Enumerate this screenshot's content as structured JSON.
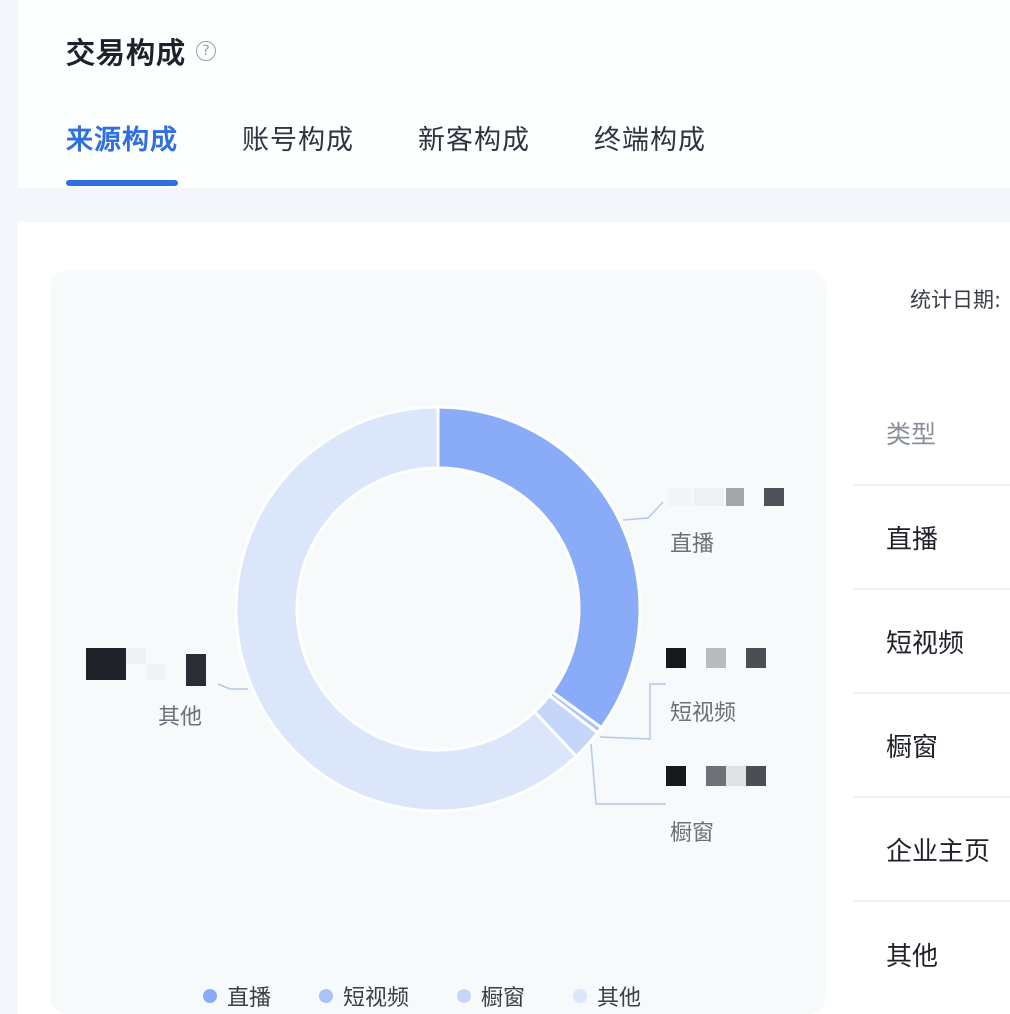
{
  "header": {
    "title": "交易构成",
    "help_icon": "question-circle-icon",
    "tabs": [
      {
        "label": "来源构成",
        "active": true
      },
      {
        "label": "账号构成",
        "active": false
      },
      {
        "label": "新客构成",
        "active": false
      },
      {
        "label": "终端构成",
        "active": false
      }
    ]
  },
  "stat_date_label": "统计日期:",
  "chart_data": {
    "type": "pie",
    "donut": true,
    "categories": [
      "直播",
      "短视频",
      "橱窗",
      "其他"
    ],
    "values": [
      35,
      0.5,
      2.5,
      62
    ],
    "colors": [
      "#8aacf8",
      "#a9c2f7",
      "#c6d6fa",
      "#dbe6fb"
    ],
    "legend_position": "bottom"
  },
  "chart_labels": {
    "live": "直播",
    "short_video": "短视频",
    "showcase": "橱窗",
    "other": "其他"
  },
  "legend": [
    {
      "label": "直播",
      "color": "#8aacf8"
    },
    {
      "label": "短视频",
      "color": "#a9c2f7"
    },
    {
      "label": "橱窗",
      "color": "#c6d6fa"
    },
    {
      "label": "其他",
      "color": "#dbe6fb"
    }
  ],
  "table": {
    "header": "类型",
    "rows": [
      "直播",
      "短视频",
      "橱窗",
      "企业主页",
      "其他"
    ]
  },
  "accent_color": "#2f6fde"
}
